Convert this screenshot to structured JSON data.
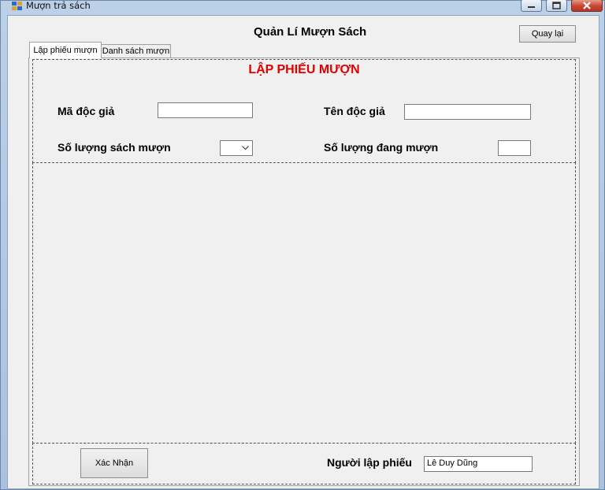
{
  "window": {
    "title": "Mượn trả sách"
  },
  "header": {
    "title": "Quản Lí Mượn Sách",
    "back_label": "Quay lại"
  },
  "tabs": [
    {
      "label": "Lập phiếu mượn",
      "active": true
    },
    {
      "label": "Danh sách mượn",
      "active": false
    }
  ],
  "form": {
    "section_title": "LẬP PHIẾU MƯỢN",
    "reader_id_label": "Mã độc giả",
    "reader_id_value": "",
    "reader_name_label": "Tên độc giả",
    "reader_name_value": "",
    "borrow_qty_label": "Số lượng sách mượn",
    "borrow_qty_value": "",
    "current_qty_label": "Số lượng đang mượn",
    "current_qty_value": "",
    "confirm_label": "Xác Nhận",
    "creator_label": "Người lập phiếu",
    "creator_value": "Lê Duy Dũng"
  },
  "colors": {
    "section_title": "#e00000",
    "close_button": "#c74530"
  },
  "icons": [
    "app-icon",
    "minimize-icon",
    "maximize-icon",
    "close-icon",
    "chevron-down-icon"
  ]
}
